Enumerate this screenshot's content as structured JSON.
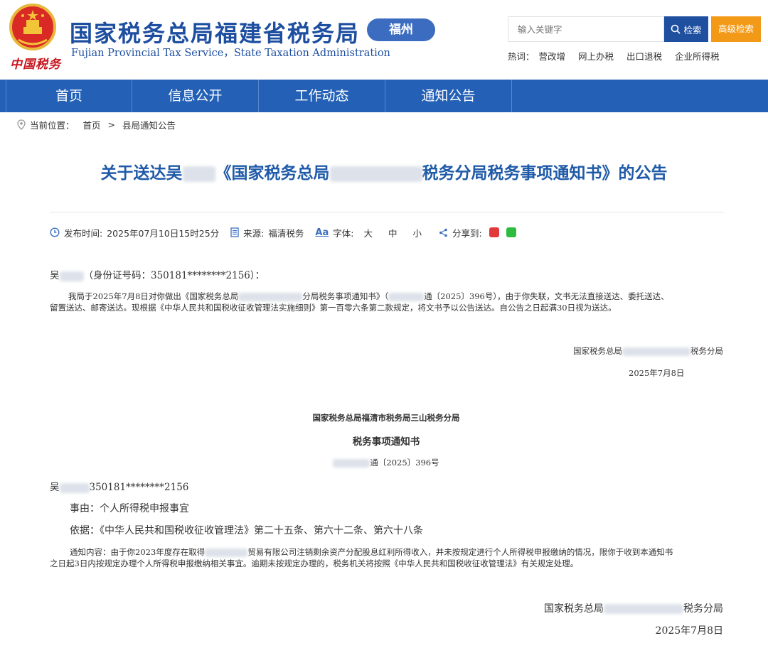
{
  "header": {
    "logo_script": "中国税务",
    "title_cn": "国家税务总局福建省税务局",
    "title_en": "Fujian Provincial Tax Service，State Taxation Administration",
    "city_badge": "福州",
    "search_placeholder": "输入关键字",
    "search_button": "检索",
    "advanced_search_button": "高级检索",
    "hotwords_label": "热词：",
    "hotwords": [
      "营改增",
      "网上办税",
      "出口退税",
      "企业所得税"
    ]
  },
  "nav": {
    "items": [
      "首页",
      "信息公开",
      "工作动态",
      "通知公告"
    ]
  },
  "breadcrumb": {
    "label": "当前位置：",
    "home": "首页",
    "separator": ">",
    "current": "县局通知公告"
  },
  "article": {
    "title_prefix": "关于送达吴",
    "title_mid": "《国家税务总局",
    "title_suffix": "税务分局税务事项通知书》的公告",
    "meta": {
      "publish_label": "发布时间:",
      "publish_time": "2025年07月10日15时25分",
      "source_label": "来源:",
      "source": "福清税务",
      "font_label": "字体:",
      "font_sizes": [
        "大",
        "中",
        "小"
      ],
      "share_label": "分享到:"
    },
    "notice": {
      "addressee_prefix": "吴",
      "addressee_suffix": "（身份证号码：350181********2156）：",
      "body_line1_a": "我局于2025年7月8日对你做出《国家税务总局",
      "body_line1_b": "分局税务事项通知书》（",
      "body_line1_c": "通〔2025〕396号），由于你失联，文书无法直接送达、委托送达、",
      "body_line2": "留置送达、邮寄送达。现根据《中华人民共和国税收征收管理法实施细则》第一百零六条第二款规定，将文书予以公告送达。自公告之日起满30日视为送达。",
      "signer_prefix": "国家税务总局",
      "signer_suffix": "税务分局",
      "date": "2025年7月8日"
    },
    "attachment": {
      "org": "国家税务总局福清市税务局三山税务分局",
      "doc_title": "税务事项通知书",
      "doc_number_suffix": "通〔2025〕396号",
      "addressee_prefix": "吴",
      "addressee_id": "350181********2156",
      "reason": "事由：个人所得税申报事宜",
      "basis": "依据：《中华人民共和国税收征收管理法》第二十五条、第六十二条、第六十八条",
      "content_line1_a": "通知内容：由于你2023年度存在取得",
      "content_line1_b": "贸易有限公司注销剩余资产分配股息红利所得收入，并未按规定进行个人所得税申报缴纳的情况，限你于收到本通知书",
      "content_line2": "之日起3日内按规定办理个人所得税申报缴纳相关事宜。逾期未按规定办理的，税务机关将按照《中华人民共和国税收征收管理法》有关规定处理。",
      "signer_prefix": "国家税务总局",
      "signer_suffix": "税务分局",
      "date": "2025年7月8日"
    }
  },
  "colors": {
    "brand_blue": "#1d4ea0",
    "nav_blue": "#2360b6",
    "orange": "#f29a18",
    "title_blue": "#1f5aa8",
    "emblem_red": "#c8161d"
  }
}
